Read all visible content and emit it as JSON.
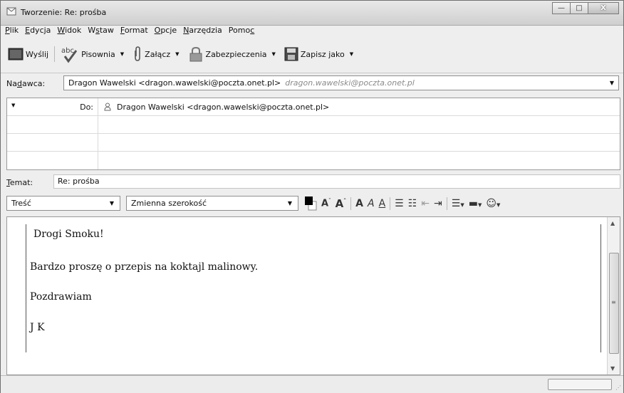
{
  "window": {
    "title": "Tworzenie: Re: prośba",
    "minimize": "—",
    "maximize": "□",
    "close": "X"
  },
  "menu": [
    {
      "pre": "",
      "u": "P",
      "post": "lik"
    },
    {
      "pre": "",
      "u": "E",
      "post": "dycja"
    },
    {
      "pre": "",
      "u": "W",
      "post": "idok"
    },
    {
      "pre": "W",
      "u": "s",
      "post": "taw"
    },
    {
      "pre": "",
      "u": "F",
      "post": "ormat"
    },
    {
      "pre": "",
      "u": "O",
      "post": "pcje"
    },
    {
      "pre": "",
      "u": "N",
      "post": "arzędzia"
    },
    {
      "pre": "Pomo",
      "u": "c",
      "post": ""
    }
  ],
  "toolbar": {
    "send": "Wyślij",
    "spell": "Pisownia",
    "attach": "Załącz",
    "security": "Zabezpieczenia",
    "save": "Zapisz jako"
  },
  "sender": {
    "label": "Nadawca:",
    "value": "Dragon Wawelski <dragon.wawelski@poczta.onet.pl>",
    "alt": "dragon.wawelski@poczta.onet.pl"
  },
  "recipients": [
    {
      "type": "Do:",
      "value": "Dragon Wawelski <dragon.wawelski@poczta.onet.pl>"
    }
  ],
  "subject": {
    "label": "Temat:",
    "value": "Re: prośba"
  },
  "format": {
    "paragraph": "Treść",
    "font": "Zmienna szerokość"
  },
  "body": [
    "Drogi Smoku!",
    "Bardzo proszę o przepis na koktajl malinowy.",
    "Pozdrawiam",
    "J K"
  ],
  "colors": {
    "text": "#000000",
    "background": "#ffffff"
  }
}
